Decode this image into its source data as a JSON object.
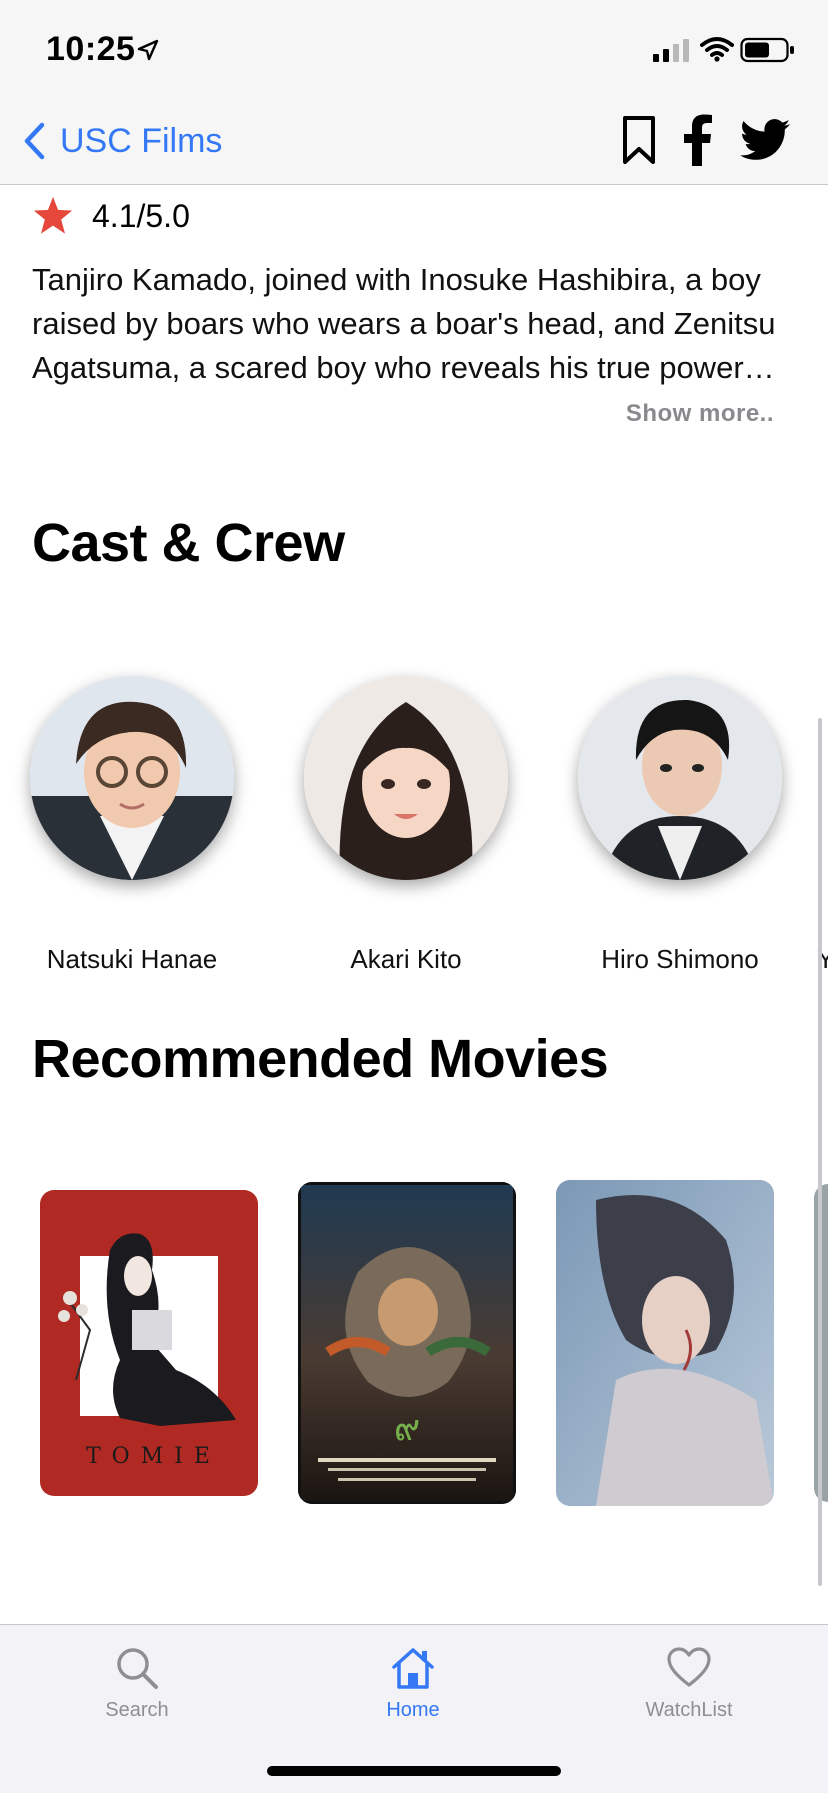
{
  "status_bar": {
    "time": "10:25"
  },
  "nav": {
    "back_label": "USC Films"
  },
  "movie": {
    "rating": "4.1/5.0",
    "overview": "Tanjiro Kamado, joined with Inosuke Hashibira, a boy raised by boars who wears a boar's head, and Zenitsu Agatsuma, a scared boy who reveals his true power when he sleeps, boards the Infinity Train on a new mission.",
    "show_more_label": "Show more.."
  },
  "cast_section": {
    "title": "Cast & Crew",
    "members": [
      {
        "name": "Natsuki Hanae"
      },
      {
        "name": "Akari Kito"
      },
      {
        "name": "Hiro Shimono"
      },
      {
        "name": "Y"
      }
    ]
  },
  "recommended_section": {
    "title": "Recommended Movies",
    "posters": [
      {
        "caption": "T O M I E"
      },
      {
        "caption": ""
      },
      {
        "caption": ""
      }
    ]
  },
  "tab_bar": {
    "tabs": [
      {
        "label": "Search",
        "icon": "search-icon"
      },
      {
        "label": "Home",
        "icon": "house-icon",
        "active": true
      },
      {
        "label": "WatchList",
        "icon": "heart-icon"
      }
    ]
  },
  "colors": {
    "accent": "#3478f6",
    "star": "#e5483a",
    "inactive": "#8e8e93"
  }
}
